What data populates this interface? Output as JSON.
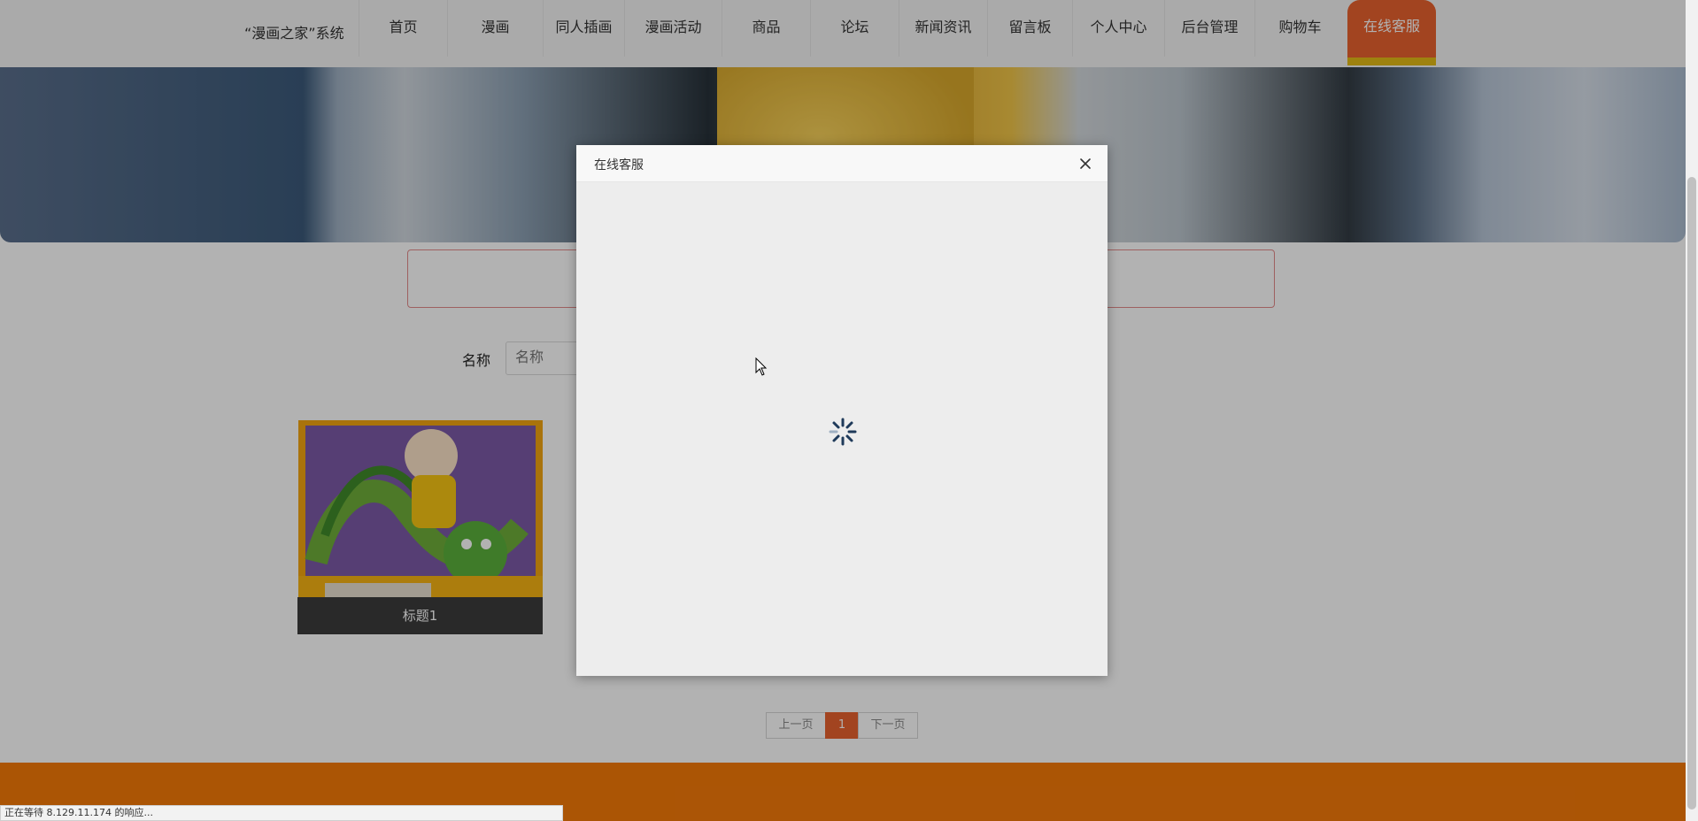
{
  "nav": {
    "brand": "“漫画之家”系统",
    "items": [
      {
        "label": "首页"
      },
      {
        "label": "漫画"
      },
      {
        "label": "同人插画"
      },
      {
        "label": "漫画活动"
      },
      {
        "label": "商品"
      },
      {
        "label": "论坛"
      },
      {
        "label": "新闻资讯"
      },
      {
        "label": "留言板"
      },
      {
        "label": "个人中心"
      },
      {
        "label": "后台管理"
      },
      {
        "label": "购物车"
      },
      {
        "label": "在线客服"
      }
    ],
    "active_color": "#e8622e",
    "active_underline_color": "#e2bb16"
  },
  "search": {
    "label": "名称",
    "placeholder": "名称"
  },
  "cards": [
    {
      "title": "标题1"
    }
  ],
  "pagination": {
    "prev": "上一页",
    "current": "1",
    "next": "下一页"
  },
  "modal": {
    "title": "在线客服",
    "close_icon": "close-icon",
    "spinner_icon": "loading-spinner-icon"
  },
  "status_bar": {
    "text": "正在等待 8.129.11.174 的响应..."
  },
  "colors": {
    "footer": "#f57a08",
    "accent": "#e8622e"
  }
}
